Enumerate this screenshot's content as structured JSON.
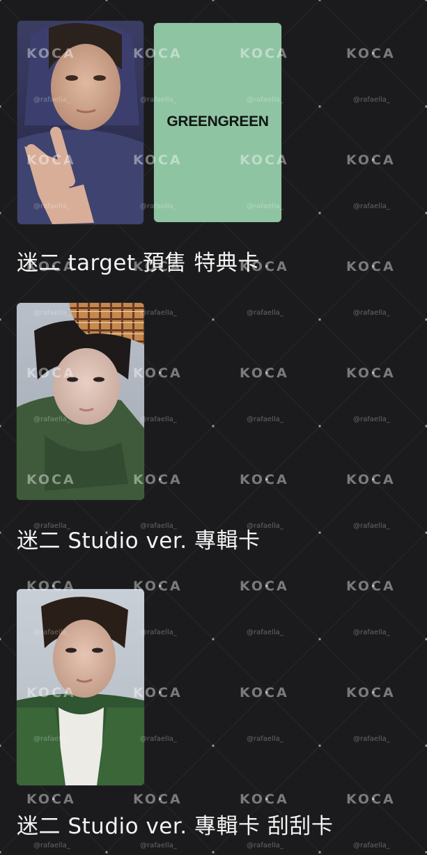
{
  "watermark": {
    "logo": "KOCA",
    "handle": "@rafaella_"
  },
  "sections": [
    {
      "caption": "迷二 target 預售 特典卡",
      "cards": [
        {
          "type": "photo",
          "subject": "boy in dark hoodie making peace sign"
        },
        {
          "type": "text",
          "text": "GREENGREEN",
          "color": "#8fc4a3"
        }
      ]
    },
    {
      "caption": "迷二 Studio ver. 專輯卡",
      "cards": [
        {
          "type": "photo",
          "subject": "boy in plaid cap and green jacket seen from above"
        }
      ]
    },
    {
      "caption": "迷二 Studio ver. 專輯卡 刮刮卡",
      "cards": [
        {
          "type": "photo",
          "subject": "boy in green jacket over white shirt"
        }
      ]
    }
  ],
  "colors": {
    "background": "#1b1b1d",
    "text": "#f3f3f3",
    "card_green": "#8fc4a3"
  }
}
